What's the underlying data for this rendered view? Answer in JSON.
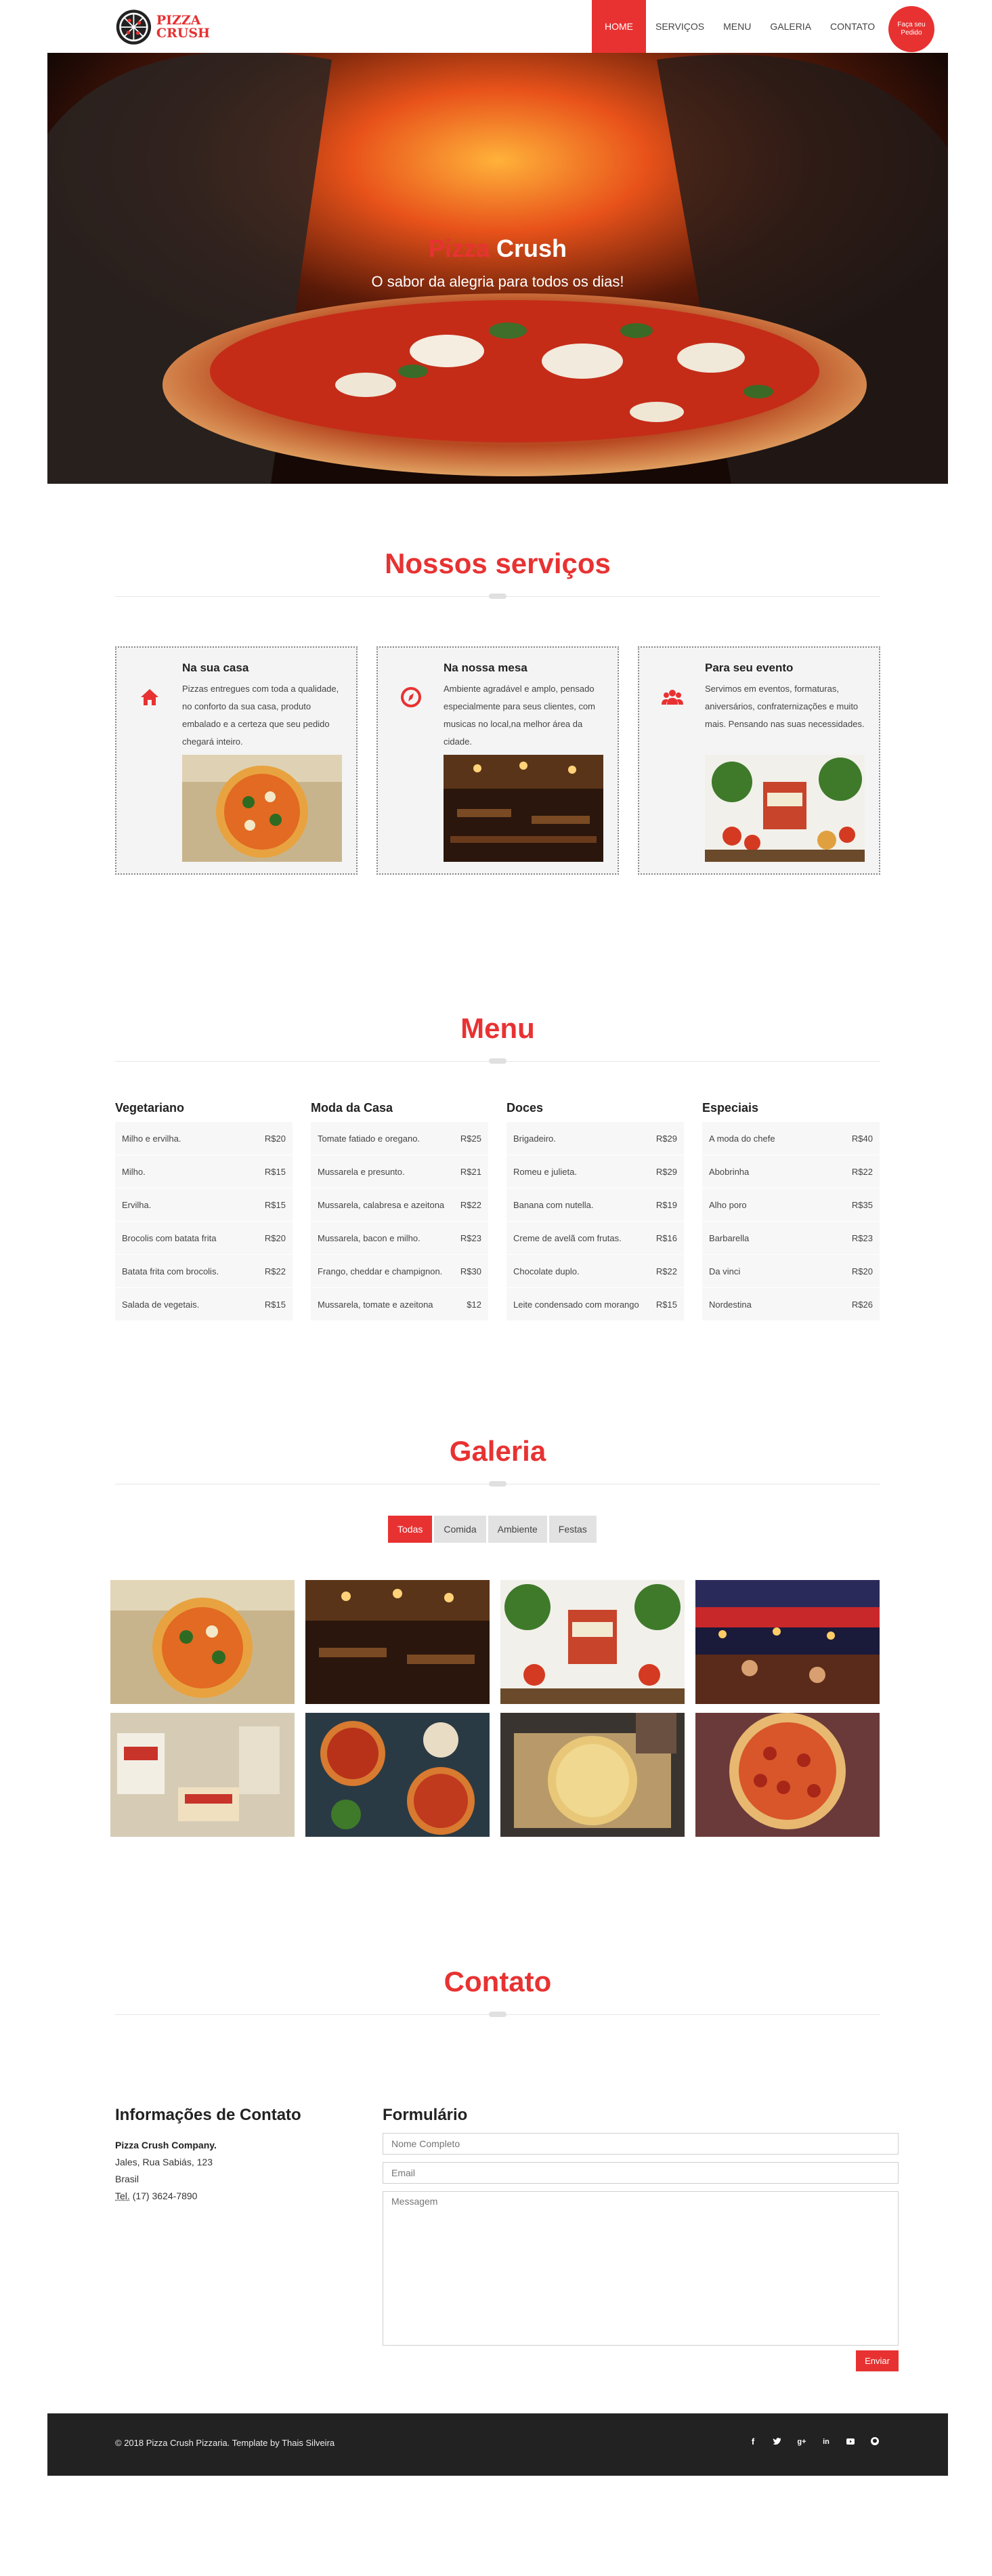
{
  "brand": {
    "logo_line1": "PIZZA",
    "logo_line2": "CRUSH"
  },
  "nav": {
    "items": [
      "HOME",
      "SERVIÇOS",
      "MENU",
      "GALERIA",
      "CONTATO"
    ],
    "order_button": "Faça seu Pedido"
  },
  "hero": {
    "title_part1": "Pizza",
    "title_part2": "Crush",
    "subtitle": "O sabor da alegria para todos os dias!"
  },
  "services": {
    "title": "Nossos serviços",
    "cards": [
      {
        "icon": "home-icon",
        "title": "Na sua casa",
        "text": "Pizzas entregues com toda a qualidade, no conforto da sua casa, produto embalado e a certeza que seu pedido chegará inteiro."
      },
      {
        "icon": "compass-icon",
        "title": "Na nossa mesa",
        "text": "Ambiente agradável e amplo, pensado especialmente para seus clientes, com musicas no local,na melhor área da cidade."
      },
      {
        "icon": "users-icon",
        "title": "Para seu evento",
        "text": "Servimos em eventos, formaturas, aniversários, confraternizações e muito mais. Pensando nas suas necessidades."
      }
    ]
  },
  "menu": {
    "title": "Menu",
    "columns": [
      {
        "category": "Vegetariano",
        "items": [
          {
            "name": "Milho e ervilha.",
            "price": "R$20"
          },
          {
            "name": "Milho.",
            "price": "R$15"
          },
          {
            "name": "Ervilha.",
            "price": "R$15"
          },
          {
            "name": "Brocolis com batata frita",
            "price": "R$20"
          },
          {
            "name": "Batata frita com brocolis.",
            "price": "R$22"
          },
          {
            "name": "Salada de vegetais.",
            "price": "R$15"
          }
        ]
      },
      {
        "category": "Moda da Casa",
        "items": [
          {
            "name": "Tomate fatiado e oregano.",
            "price": "R$25"
          },
          {
            "name": "Mussarela e presunto.",
            "price": "R$21"
          },
          {
            "name": "Mussarela, calabresa e azeitona",
            "price": "R$22"
          },
          {
            "name": "Mussarela, bacon e milho.",
            "price": "R$23"
          },
          {
            "name": "Frango, cheddar e champignon.",
            "price": "R$30"
          },
          {
            "name": "Mussarela, tomate e azeitona",
            "price": "$12"
          }
        ]
      },
      {
        "category": "Doces",
        "items": [
          {
            "name": "Brigadeiro.",
            "price": "R$29"
          },
          {
            "name": "Romeu e julieta.",
            "price": "R$29"
          },
          {
            "name": "Banana com nutella.",
            "price": "R$19"
          },
          {
            "name": "Creme de avelã com frutas.",
            "price": "R$16"
          },
          {
            "name": "Chocolate duplo.",
            "price": "R$22"
          },
          {
            "name": "Leite condensado com morango",
            "price": "R$15"
          }
        ]
      },
      {
        "category": "Especiais",
        "items": [
          {
            "name": "A moda do chefe",
            "price": "R$40"
          },
          {
            "name": "Abobrinha",
            "price": "R$22"
          },
          {
            "name": "Alho poro",
            "price": "R$35"
          },
          {
            "name": "Barbarella",
            "price": "R$23"
          },
          {
            "name": "Da vinci",
            "price": "R$20"
          },
          {
            "name": "Nordestina",
            "price": "R$26"
          }
        ]
      }
    ]
  },
  "gallery": {
    "title": "Galeria",
    "filters": [
      "Todas",
      "Comida",
      "Ambiente",
      "Festas"
    ],
    "active_filter": "Todas"
  },
  "contact": {
    "title": "Contato",
    "info_heading": "Informações de Contato",
    "company": "Pizza Crush Company.",
    "address": "Jales, Rua Sabiás, 123",
    "country": "Brasil",
    "phone_label": "Tel.",
    "phone": "(17) 3624-7890",
    "form_heading": "Formulário",
    "name_placeholder": "Nome Completo",
    "email_placeholder": "Email",
    "message_placeholder": "Messagem",
    "send_label": "Enviar"
  },
  "footer": {
    "text": "© 2018 Pizza Crush Pizzaria. Template by Thais Silveira",
    "social_icons": [
      "facebook-icon",
      "twitter-icon",
      "google-plus-icon",
      "linkedin-icon",
      "youtube-icon",
      "github-icon"
    ]
  },
  "colors": {
    "accent": "#e83232",
    "footer_bg": "#222222",
    "card_bg": "#f4f4f4"
  }
}
